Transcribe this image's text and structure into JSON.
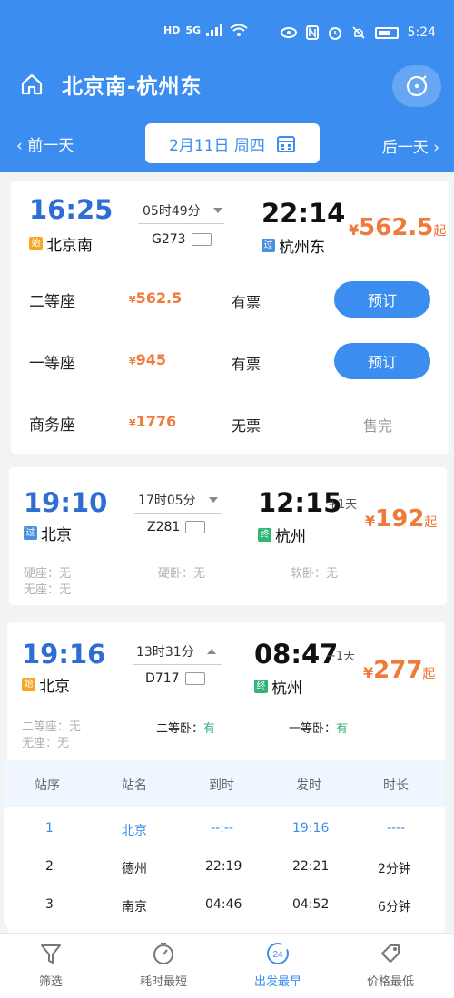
{
  "status_bar": {
    "network": "HD",
    "signal": "5G",
    "time": "5:24"
  },
  "header": {
    "title": "北京南-杭州东"
  },
  "date_nav": {
    "prev_label": "前一天",
    "date_label": "2月11日 周四",
    "next_label": "后一天"
  },
  "trains": [
    {
      "dep_time": "16:25",
      "dep_tag": "始",
      "dep_station": "北京南",
      "duration": "05时49分",
      "train_no": "G273",
      "arr_time": "22:14",
      "arr_tag": "过",
      "arr_station": "杭州东",
      "price_currency": "¥",
      "price": "562.5",
      "price_suffix": "起",
      "seats": [
        {
          "name": "二等座",
          "currency": "¥",
          "price": "562.5",
          "availability": "有票",
          "action": "预订"
        },
        {
          "name": "一等座",
          "currency": "¥",
          "price": "945",
          "availability": "有票",
          "action": "预订"
        },
        {
          "name": "商务座",
          "currency": "¥",
          "price": "1776",
          "availability": "无票",
          "action": "售完"
        }
      ]
    },
    {
      "dep_time": "19:10",
      "dep_tag": "过",
      "dep_station": "北京",
      "duration": "17时05分",
      "train_no": "Z281",
      "arr_time": "12:15",
      "arr_plus": "+1天",
      "arr_tag": "终",
      "arr_station": "杭州",
      "price_currency": "¥",
      "price": "192",
      "price_suffix": "起",
      "mini_seats": [
        "硬座：无",
        "硬卧：无",
        "软卧：无",
        "无座：无"
      ]
    },
    {
      "dep_time": "19:16",
      "dep_tag": "始",
      "dep_station": "北京",
      "duration": "13时31分",
      "train_no": "D717",
      "arr_time": "08:47",
      "arr_plus": "+1天",
      "arr_tag": "终",
      "arr_station": "杭州",
      "price_currency": "¥",
      "price": "277",
      "price_suffix": "起",
      "mini_seats": [
        "二等座：无",
        "无座：无"
      ],
      "strong_seats": [
        {
          "label": "二等卧：",
          "value": "有"
        },
        {
          "label": "一等卧：",
          "value": "有"
        }
      ],
      "stops_header": [
        "站序",
        "站名",
        "到时",
        "发时",
        "时长"
      ],
      "stops": [
        [
          "1",
          "北京",
          "--:--",
          "19:16",
          "----"
        ],
        [
          "2",
          "德州",
          "22:19",
          "22:21",
          "2分钟"
        ],
        [
          "3",
          "南京",
          "04:46",
          "04:52",
          "6分钟"
        ]
      ]
    }
  ],
  "bottom_nav": [
    {
      "label": "筛选",
      "icon": "filter-icon"
    },
    {
      "label": "耗时最短",
      "icon": "stopwatch-icon"
    },
    {
      "label": "出发最早",
      "icon": "clock-24-icon",
      "active": true
    },
    {
      "label": "价格最低",
      "icon": "price-tag-icon"
    }
  ],
  "colors": {
    "primary": "#3b8df0",
    "price": "#f07a3a",
    "green": "#2fb574"
  }
}
